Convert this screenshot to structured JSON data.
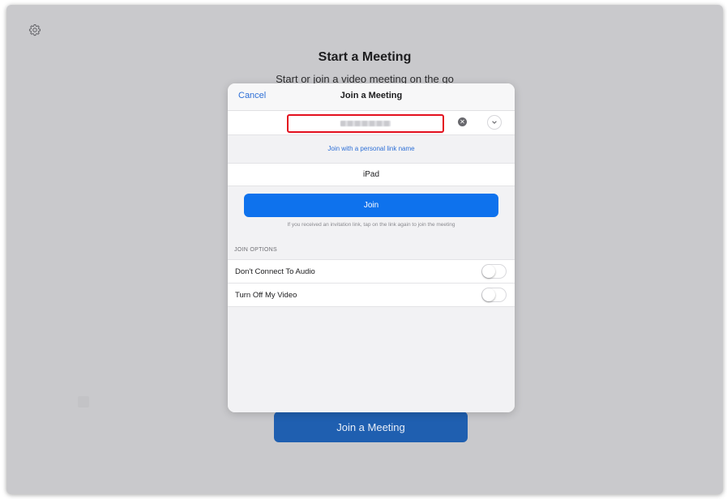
{
  "background": {
    "title": "Start a Meeting",
    "subtitle": "Start or join a video meeting on the go",
    "join_button_label": "Join a Meeting"
  },
  "modal": {
    "cancel_label": "Cancel",
    "title": "Join a Meeting",
    "meeting_id_input": {
      "value": "",
      "obscured": true,
      "highlight_color": "#e3101e"
    },
    "personal_link_label": "Join with a personal link name",
    "display_name": "iPad",
    "join_button_label": "Join",
    "join_hint": "If you received an invitation link, tap on the link again to join the meeting",
    "join_options_header": "JOIN OPTIONS",
    "options": [
      {
        "label": "Don't Connect To Audio",
        "enabled": false
      },
      {
        "label": "Turn Off My Video",
        "enabled": false
      }
    ]
  },
  "colors": {
    "accent": "#0e72ed",
    "link": "#2d6fd6",
    "backdrop": "#c9c9cc"
  },
  "icons": {
    "settings": "gear-icon",
    "clear": "clear-icon",
    "dropdown": "chevron-down-icon"
  }
}
